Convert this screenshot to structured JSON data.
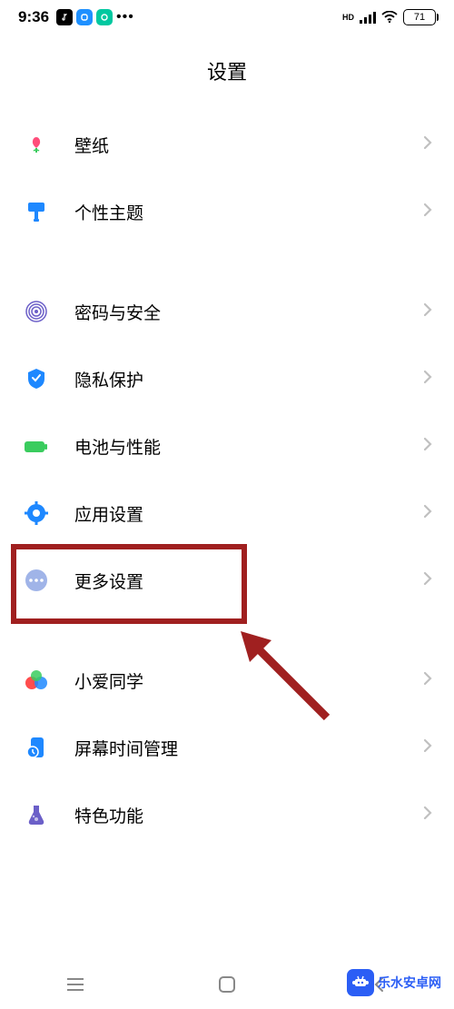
{
  "statusBar": {
    "time": "9:36",
    "batteryLevel": "71"
  },
  "pageTitle": "设置",
  "groups": [
    {
      "items": [
        {
          "id": "wallpaper",
          "label": "壁纸",
          "iconColor": "#ff4d7a"
        },
        {
          "id": "themes",
          "label": "个性主题",
          "iconColor": "#1e88ff"
        }
      ]
    },
    {
      "items": [
        {
          "id": "security",
          "label": "密码与安全",
          "iconColor": "#6b5fc8"
        },
        {
          "id": "privacy",
          "label": "隐私保护",
          "iconColor": "#1e88ff"
        },
        {
          "id": "battery",
          "label": "电池与性能",
          "iconColor": "#3acc5e"
        },
        {
          "id": "apps",
          "label": "应用设置",
          "iconColor": "#1e88ff"
        },
        {
          "id": "more",
          "label": "更多设置",
          "iconColor": "#a0b4e8",
          "highlighted": true
        }
      ]
    },
    {
      "items": [
        {
          "id": "xiaoai",
          "label": "小爱同学",
          "iconColor": "#ff4d4d"
        },
        {
          "id": "screentime",
          "label": "屏幕时间管理",
          "iconColor": "#1e88ff"
        },
        {
          "id": "features",
          "label": "特色功能",
          "iconColor": "#6b5fc8"
        }
      ]
    }
  ],
  "watermark": "乐水安卓网"
}
